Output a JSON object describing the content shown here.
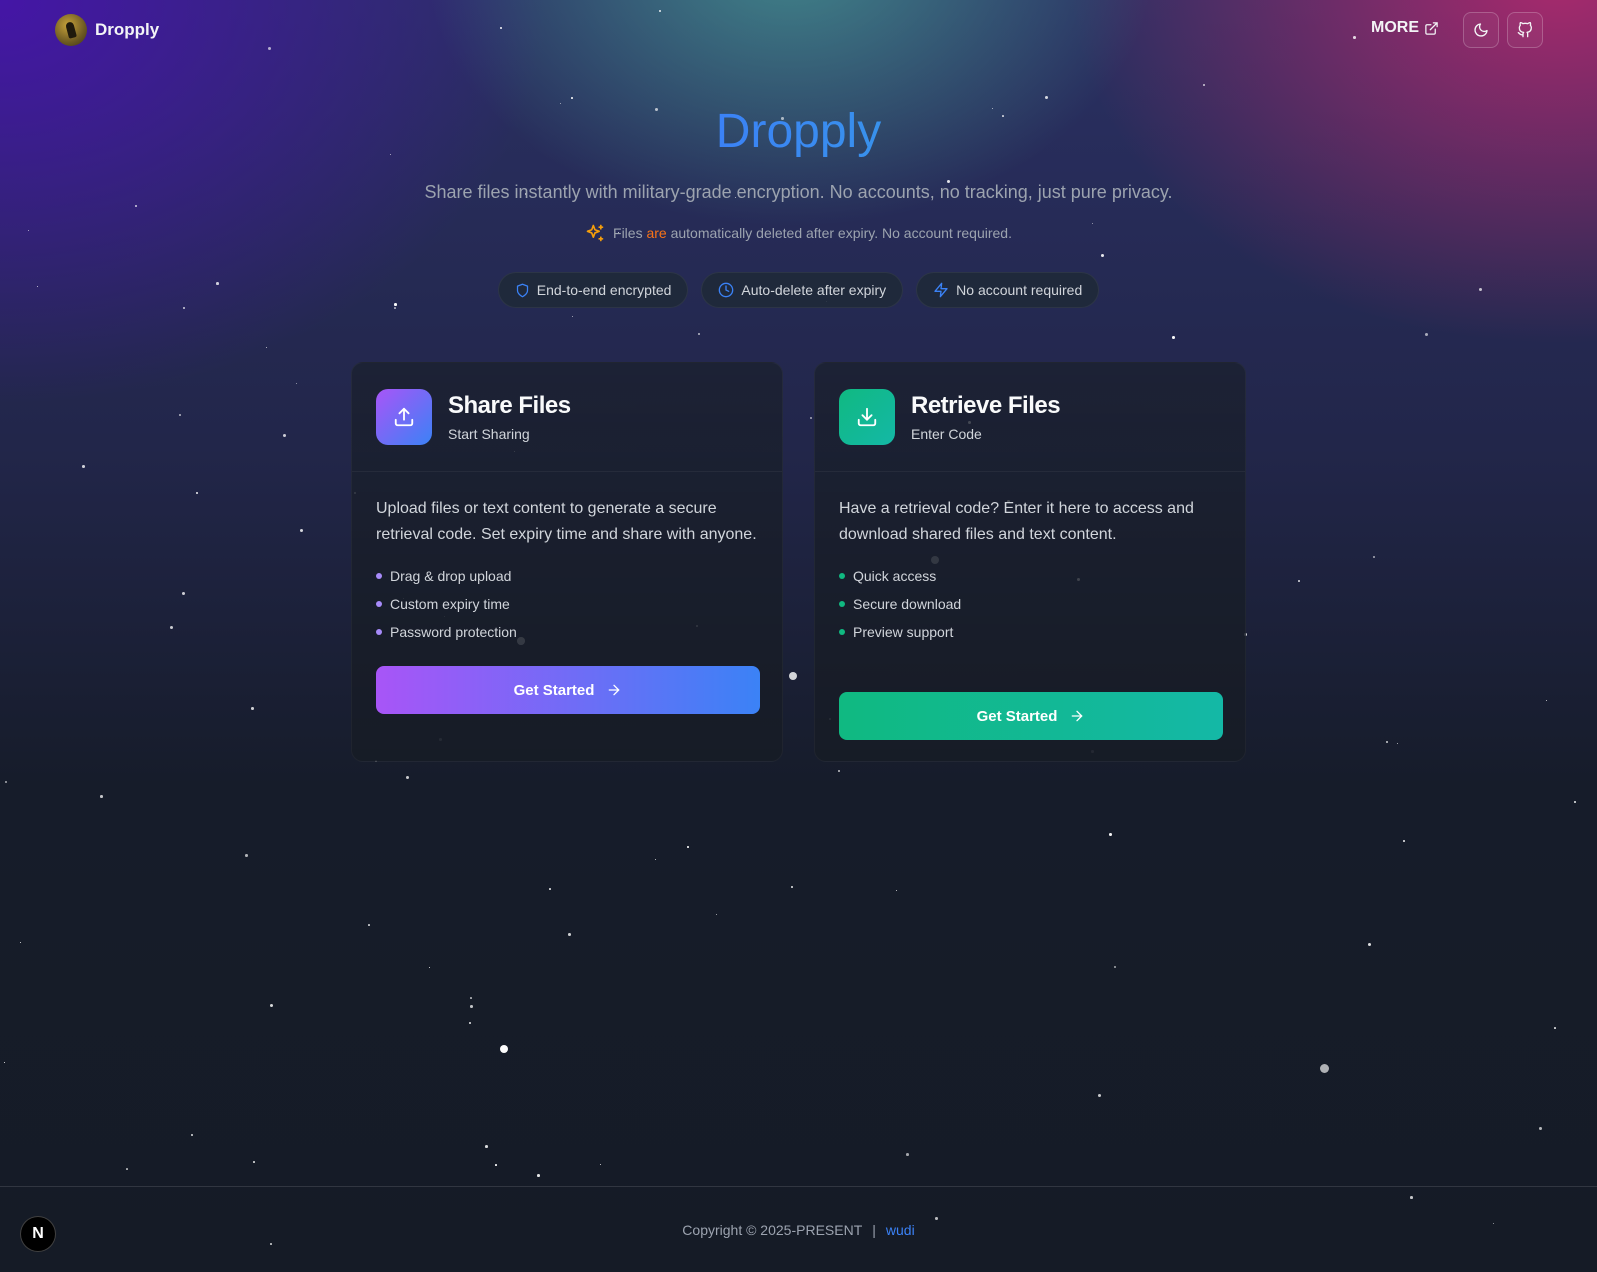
{
  "nav": {
    "brand_name": "Dropply",
    "more_label": "MORE",
    "theme_toggle_icon": "moon-icon",
    "github_icon": "github-icon"
  },
  "hero": {
    "title": "Dropply",
    "subtitle": "Share files instantly with military-grade encryption. No accounts, no tracking, just pure privacy.",
    "notice_before": "Files ",
    "notice_highlight": "are",
    "notice_after": " automatically deleted after expiry. No account required.",
    "notice_icon": "sparkles-icon"
  },
  "badges": [
    {
      "label": "End-to-end encrypted",
      "icon": "shield-icon"
    },
    {
      "label": "Auto-delete after expiry",
      "icon": "clock-icon"
    },
    {
      "label": "No account required",
      "icon": "zap-icon"
    }
  ],
  "cards": {
    "share": {
      "title": "Share Files",
      "subtitle": "Start Sharing",
      "description": "Upload files or text content to generate a secure retrieval code. Set expiry time and share with anyone.",
      "features": [
        "Drag & drop upload",
        "Custom expiry time",
        "Password protection"
      ],
      "button_label": "Get Started",
      "icon": "upload-icon"
    },
    "retrieve": {
      "title": "Retrieve Files",
      "subtitle": "Enter Code",
      "description": "Have a retrieval code? Enter it here to access and download shared files and text content.",
      "features": [
        "Quick access",
        "Secure download",
        "Preview support"
      ],
      "button_label": "Get Started",
      "icon": "download-icon"
    }
  },
  "footer": {
    "copyright": "Copyright © 2025-PRESENT",
    "separator": "|",
    "author": "wudi"
  },
  "dev_badge": "N",
  "colors": {
    "share_gradient": [
      "#a855f7",
      "#3b82f6"
    ],
    "retrieve_gradient": [
      "#10b981",
      "#14b8a6"
    ],
    "accent_link": "#3b82f6",
    "notice_highlight": "#f97316"
  }
}
